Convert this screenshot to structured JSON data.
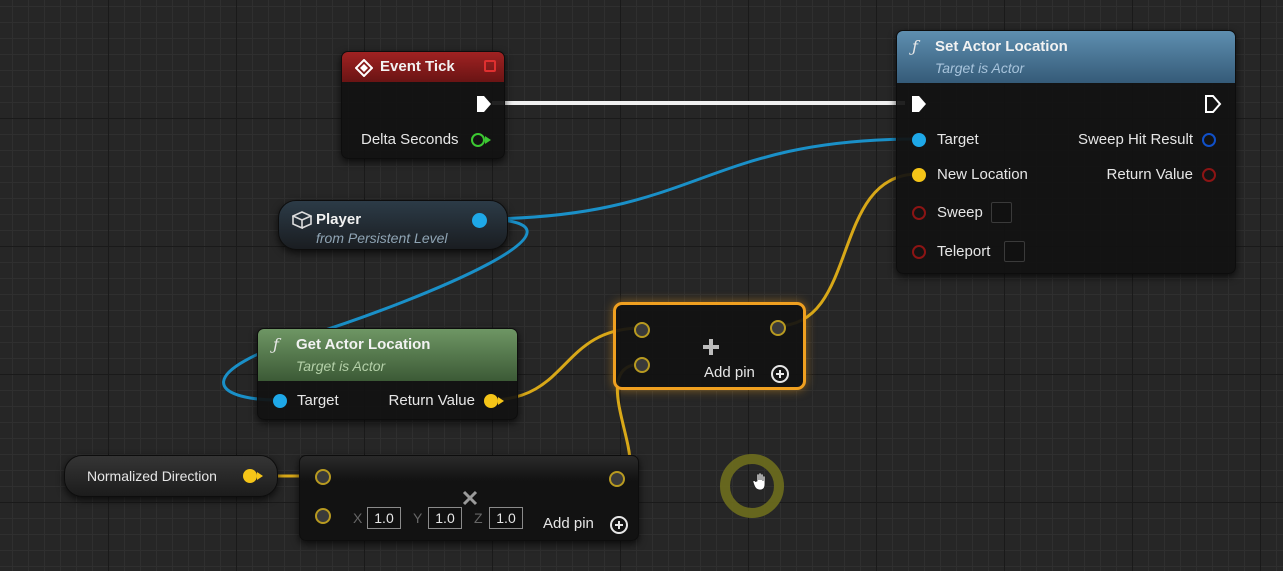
{
  "event_tick": {
    "title": "Event Tick",
    "delta_seconds": "Delta Seconds"
  },
  "set_actor_location": {
    "title": "Set Actor Location",
    "subtitle": "Target is Actor",
    "target": "Target",
    "new_location": "New Location",
    "sweep": "Sweep",
    "teleport": "Teleport",
    "sweep_hit_result": "Sweep Hit Result",
    "return_value": "Return Value"
  },
  "player": {
    "title": "Player",
    "subtitle": "from Persistent Level"
  },
  "get_actor_location": {
    "title": "Get Actor Location",
    "subtitle": "Target is Actor",
    "target": "Target",
    "return_value": "Return Value"
  },
  "add_node": {
    "add_pin": "Add pin"
  },
  "normalized_direction": {
    "label": "Normalized Direction"
  },
  "multiply_node": {
    "x_label": "X",
    "x_value": "1.0",
    "y_label": "Y",
    "y_value": "1.0",
    "z_label": "Z",
    "z_value": "1.0",
    "add_pin": "Add pin"
  },
  "colors": {
    "exec": "#ffffff",
    "object_pin": "#1ea8e8",
    "vector_pin": "#f5c518",
    "bool_pin": "#8c1414",
    "float_pin": "#3cc832",
    "struct_pin": "#1050c8",
    "event_header": "#8a1a1a",
    "function_header_blue": "#4a7a9a",
    "function_header_green": "#5a8050",
    "selection": "#f0a020",
    "cursor_ring": "#6e6e1e"
  },
  "icons": [
    "event-diamond-icon",
    "function-icon",
    "cube-icon",
    "plus-icon",
    "multiply-icon",
    "hand-cursor-icon",
    "add-pin-icon"
  ]
}
